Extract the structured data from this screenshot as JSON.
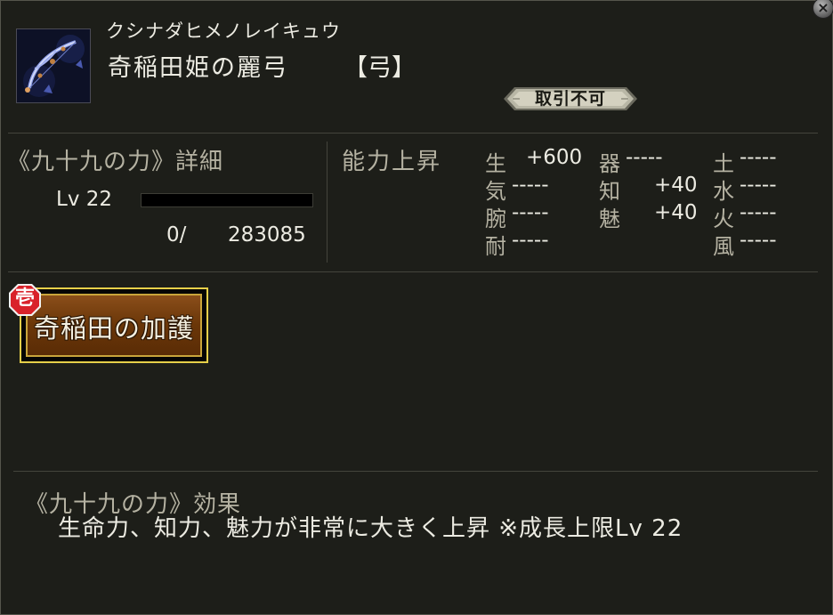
{
  "window": {
    "close_symbol": "×"
  },
  "item": {
    "icon": "bow-icon",
    "reading": "クシナダヒメノレイキュウ",
    "name": "奇稲田姫の麗弓",
    "type": "【弓】",
    "trade_status": "取引不可"
  },
  "growth": {
    "title": "《九十九の力》詳細",
    "level_label": "Lv 22",
    "exp_current": "0/",
    "exp_max": "283085",
    "exp_fraction": 0
  },
  "stats": {
    "title": "能力上昇",
    "rows": [
      [
        {
          "label": "生",
          "value": "+600"
        },
        {
          "label": "器",
          "value": "-----"
        },
        {
          "label": "土",
          "value": "-----"
        }
      ],
      [
        {
          "label": "気",
          "value": "-----"
        },
        {
          "label": "知",
          "value": "+40"
        },
        {
          "label": "水",
          "value": "-----"
        }
      ],
      [
        {
          "label": "腕",
          "value": "-----"
        },
        {
          "label": "魅",
          "value": "+40"
        },
        {
          "label": "火",
          "value": "-----"
        }
      ],
      [
        {
          "label": "耐",
          "value": "-----"
        },
        {
          "label": "",
          "value": ""
        },
        {
          "label": "風",
          "value": "-----"
        }
      ]
    ]
  },
  "skill": {
    "rank_badge": "壱",
    "label": "奇稲田の加護"
  },
  "effect": {
    "title": "《九十九の力》効果",
    "description": "生命力、知力、魅力が非常に大きく上昇 ※成長上限Lv 22"
  },
  "colors": {
    "panel_bg": "#1d1e19",
    "text_main": "#ecebe2",
    "text_dim": "#b5b2a2",
    "skill_border": "#e6cf49",
    "badge_red": "#d9222a"
  }
}
